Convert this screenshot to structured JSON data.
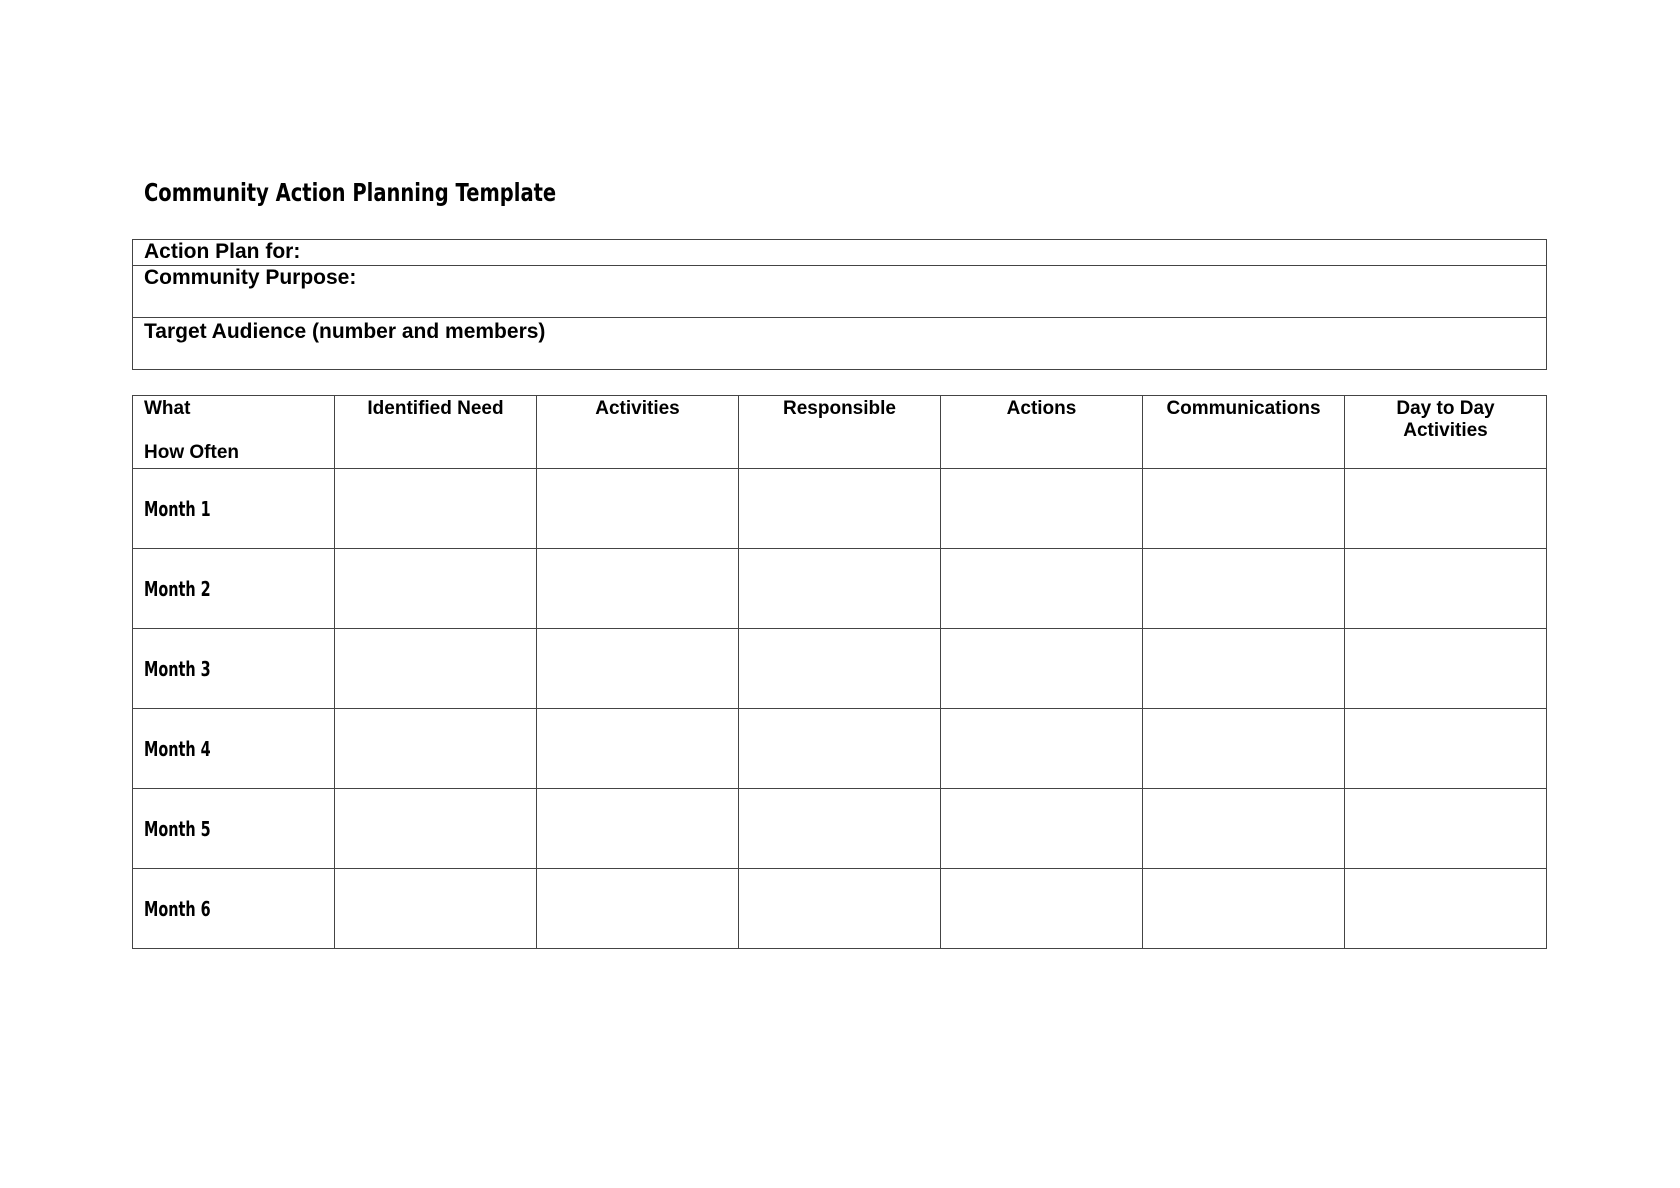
{
  "document": {
    "title": "Community Action Planning Template"
  },
  "info": {
    "action_plan_for": "Action Plan for:",
    "community_purpose": "Community Purpose:",
    "target_audience": "Target Audience (number and members)"
  },
  "plan_table": {
    "header": {
      "first_line1": "What",
      "first_line2": "How Often",
      "columns": [
        "Identified Need",
        "Activities",
        "Responsible",
        "Actions",
        "Communications",
        "Day to Day Activities"
      ]
    },
    "rows": [
      {
        "label": "Month 1",
        "cells": [
          "",
          "",
          "",
          "",
          "",
          ""
        ]
      },
      {
        "label": "Month 2",
        "cells": [
          "",
          "",
          "",
          "",
          "",
          ""
        ]
      },
      {
        "label": "Month 3",
        "cells": [
          "",
          "",
          "",
          "",
          "",
          ""
        ]
      },
      {
        "label": "Month 4",
        "cells": [
          "",
          "",
          "",
          "",
          "",
          ""
        ]
      },
      {
        "label": "Month 5",
        "cells": [
          "",
          "",
          "",
          "",
          "",
          ""
        ]
      },
      {
        "label": "Month 6",
        "cells": [
          "",
          "",
          "",
          "",
          "",
          ""
        ]
      }
    ]
  }
}
